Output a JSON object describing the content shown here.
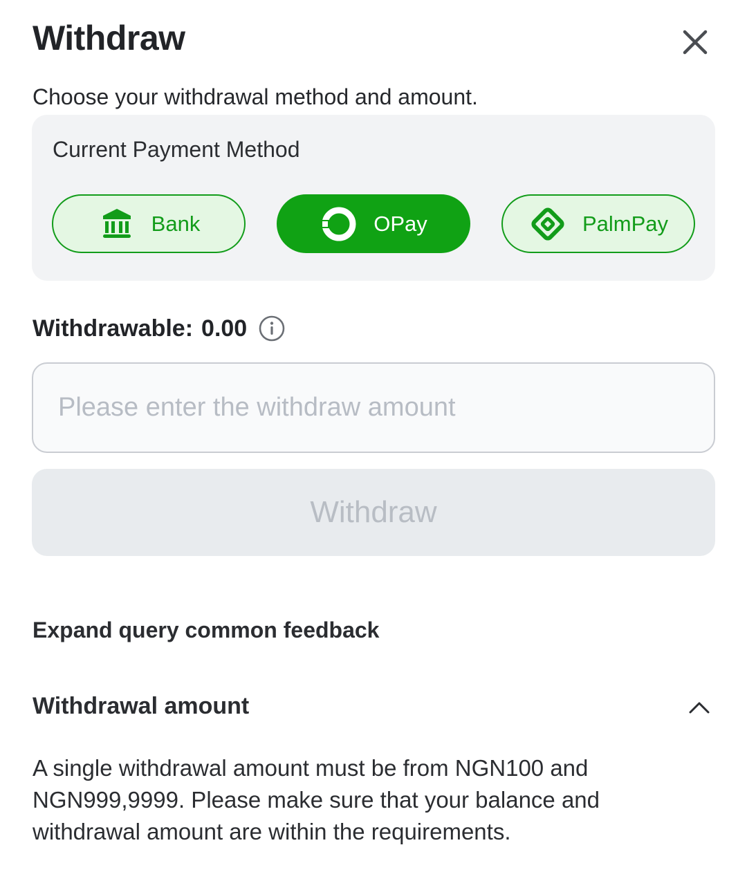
{
  "header": {
    "title": "Withdraw",
    "close_icon": "close-icon",
    "subtitle": "Choose your withdrawal method and amount."
  },
  "payment": {
    "label": "Current Payment Method",
    "methods": [
      {
        "label": "Bank",
        "icon": "bank-icon",
        "selected": false
      },
      {
        "label": "OPay",
        "icon": "opay-logo-icon",
        "selected": true
      },
      {
        "label": "PalmPay",
        "icon": "palmpay-logo-icon",
        "selected": false
      }
    ]
  },
  "balance": {
    "label": "Withdrawable:",
    "value": "0.00",
    "info_icon": "info-icon"
  },
  "amount": {
    "placeholder": "Please enter the withdraw amount",
    "value": ""
  },
  "action": {
    "withdraw_label": "Withdraw",
    "enabled": false
  },
  "faq": {
    "heading": "Expand query common feedback",
    "items": [
      {
        "title": "Withdrawal amount",
        "expanded": true,
        "body": "A single withdrawal amount must be from NGN100 and NGN999,9999. Please make sure that your balance and withdrawal amount are within the requirements."
      }
    ]
  },
  "colors": {
    "accent": "#10a214",
    "accent_light": "#e4f7e3",
    "card_bg": "#f2f3f5",
    "disabled_bg": "#e8ebee",
    "disabled_text": "#b8bdc4"
  }
}
